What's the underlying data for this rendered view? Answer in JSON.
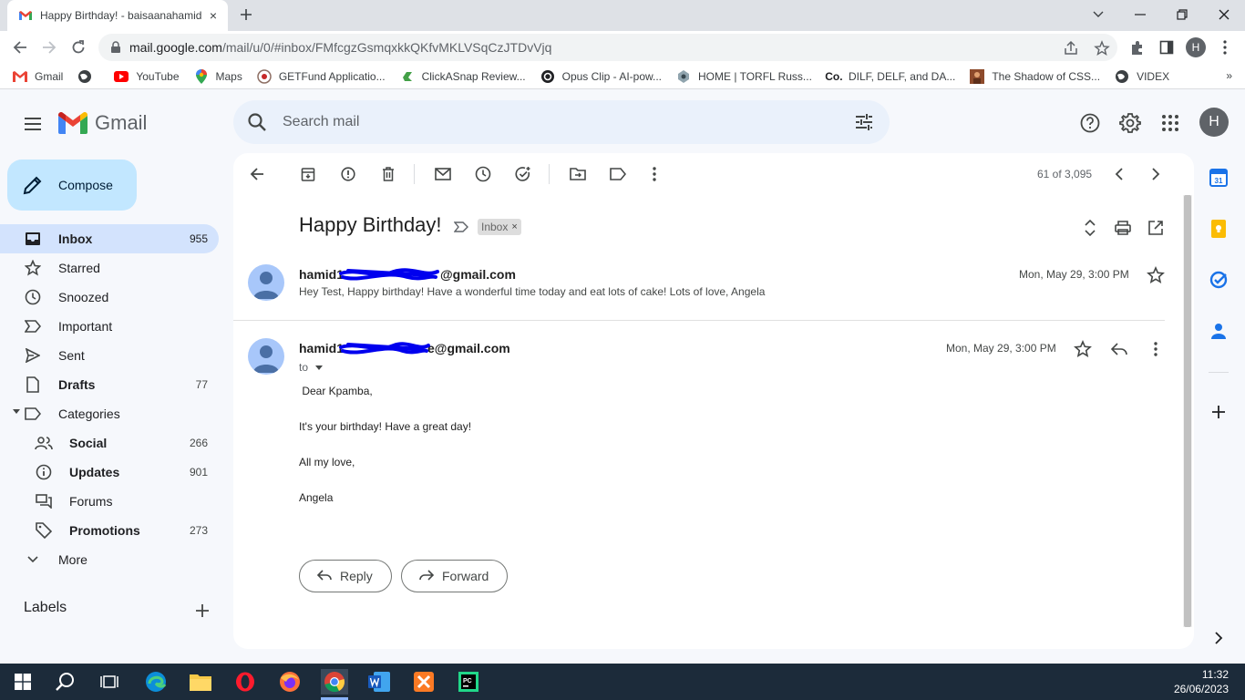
{
  "browser": {
    "tab_title": "Happy Birthday! - baisaanahamid",
    "tab_close": "×",
    "url_host": "mail.google.com",
    "url_path": "/mail/u/0/#inbox/FMfcgzGsmqxkkQKfvMKLVSqCzJTDvVjq",
    "profile_initial": "H"
  },
  "bookmarks": [
    {
      "label": "Gmail",
      "icon": "gmail-icon"
    },
    {
      "label": "",
      "icon": "globe-icon"
    },
    {
      "label": "YouTube",
      "icon": "youtube-icon"
    },
    {
      "label": "Maps",
      "icon": "maps-icon"
    },
    {
      "label": "GETFund Applicatio...",
      "icon": "getfund-icon"
    },
    {
      "label": "ClickASnap Review...",
      "icon": "clickasnap-icon"
    },
    {
      "label": "Opus Clip - AI-pow...",
      "icon": "opus-icon"
    },
    {
      "label": "HOME | TORFL Russ...",
      "icon": "torfl-icon"
    },
    {
      "label": "DILF, DELF, and DA...",
      "icon": "co-icon"
    },
    {
      "label": "The Shadow of CSS...",
      "icon": "shadow-icon"
    },
    {
      "label": "VIDEX",
      "icon": "globe-icon"
    }
  ],
  "bookmarks_more": "»",
  "gmail": {
    "brand": "Gmail",
    "search_placeholder": "Search mail",
    "avatar_initial": "H",
    "compose_label": "Compose"
  },
  "sidebar": {
    "items": [
      {
        "label": "Inbox",
        "count": "955",
        "icon": "inbox-icon"
      },
      {
        "label": "Starred",
        "count": "",
        "icon": "star-icon"
      },
      {
        "label": "Snoozed",
        "count": "",
        "icon": "clock-icon"
      },
      {
        "label": "Important",
        "count": "",
        "icon": "important-icon"
      },
      {
        "label": "Sent",
        "count": "",
        "icon": "send-icon"
      },
      {
        "label": "Drafts",
        "count": "77",
        "icon": "draft-icon"
      },
      {
        "label": "Categories",
        "count": "",
        "icon": "label-icon"
      },
      {
        "label": "Social",
        "count": "266",
        "icon": "people-icon"
      },
      {
        "label": "Updates",
        "count": "901",
        "icon": "info-icon"
      },
      {
        "label": "Forums",
        "count": "",
        "icon": "forum-icon"
      },
      {
        "label": "Promotions",
        "count": "273",
        "icon": "tag-icon"
      },
      {
        "label": "More",
        "count": "",
        "icon": "chevron-down-icon"
      }
    ],
    "labels_header": "Labels"
  },
  "toolbar": {
    "pager": "61 of 3,095"
  },
  "thread": {
    "subject": "Happy Birthday!",
    "chip": "Inbox",
    "chip_close": "×",
    "messages": [
      {
        "sender_prefix": "hamid1",
        "sender_suffix": "@gmail.com",
        "date": "Mon, May 29, 3:00 PM",
        "snippet": "Hey Test, Happy birthday! Have a wonderful time today and eat lots of cake! Lots of love, Angela"
      },
      {
        "sender_prefix": "hamid1",
        "sender_suffix": "e@gmail.com",
        "date": "Mon, May 29, 3:00 PM",
        "to": "to",
        "body": [
          " Dear Kpamba,",
          "It's your birthday! Have a great day!",
          "All my love,",
          "Angela"
        ]
      }
    ],
    "reply_label": "Reply",
    "forward_label": "Forward"
  },
  "taskbar": {
    "time": "11:32",
    "date": "26/06/2023"
  },
  "colors": {
    "accent": "#0b57d0",
    "nav_active": "#d3e3fd",
    "compose": "#c2e7ff",
    "search_bg": "#eaf1fb",
    "redaction": "#0000ee",
    "taskbar": "#1c2b3a"
  }
}
